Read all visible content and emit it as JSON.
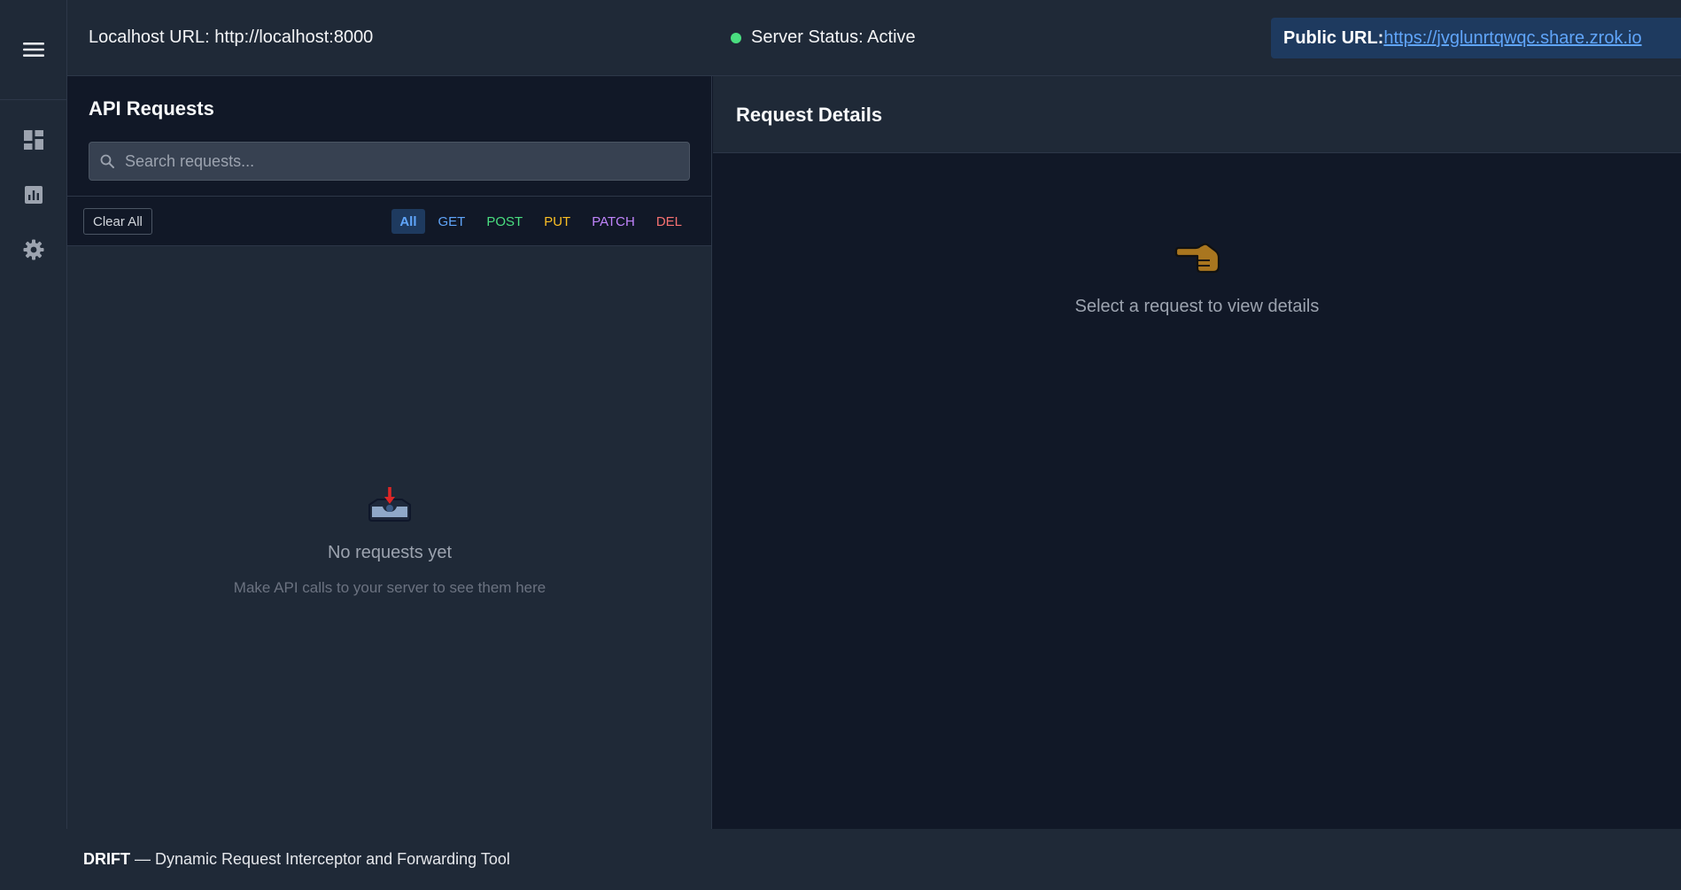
{
  "header": {
    "localhost_label": "Localhost URL: http://localhost:8000",
    "status_label": "Server Status: Active",
    "public_url_label": "Public URL:",
    "public_url": "https://jvglunrtqwqc.share.zrok.io"
  },
  "sidebar": {
    "icons": [
      "menu-icon",
      "dashboard-icon",
      "analytics-icon",
      "gear-icon"
    ]
  },
  "requests": {
    "title": "API Requests",
    "search_placeholder": "Search requests...",
    "clear_label": "Clear All",
    "filters": [
      {
        "label": "All",
        "color": "#60a5fa",
        "active": true
      },
      {
        "label": "GET",
        "color": "#60a5fa",
        "active": false
      },
      {
        "label": "POST",
        "color": "#4ade80",
        "active": false
      },
      {
        "label": "PUT",
        "color": "#fbbf24",
        "active": false
      },
      {
        "label": "PATCH",
        "color": "#c084fc",
        "active": false
      },
      {
        "label": "DEL",
        "color": "#f87171",
        "active": false
      }
    ],
    "empty_title": "No requests yet",
    "empty_subtitle": "Make API calls to your server to see them here"
  },
  "details": {
    "title": "Request Details",
    "hint": "Select a request to view details"
  },
  "footer": {
    "brand": "DRIFT",
    "tagline": "— Dynamic Request Interceptor and Forwarding Tool"
  },
  "colors": {
    "status_active": "#4ade80",
    "link": "#60a5fa",
    "accent_bg": "#1e3a5f"
  }
}
